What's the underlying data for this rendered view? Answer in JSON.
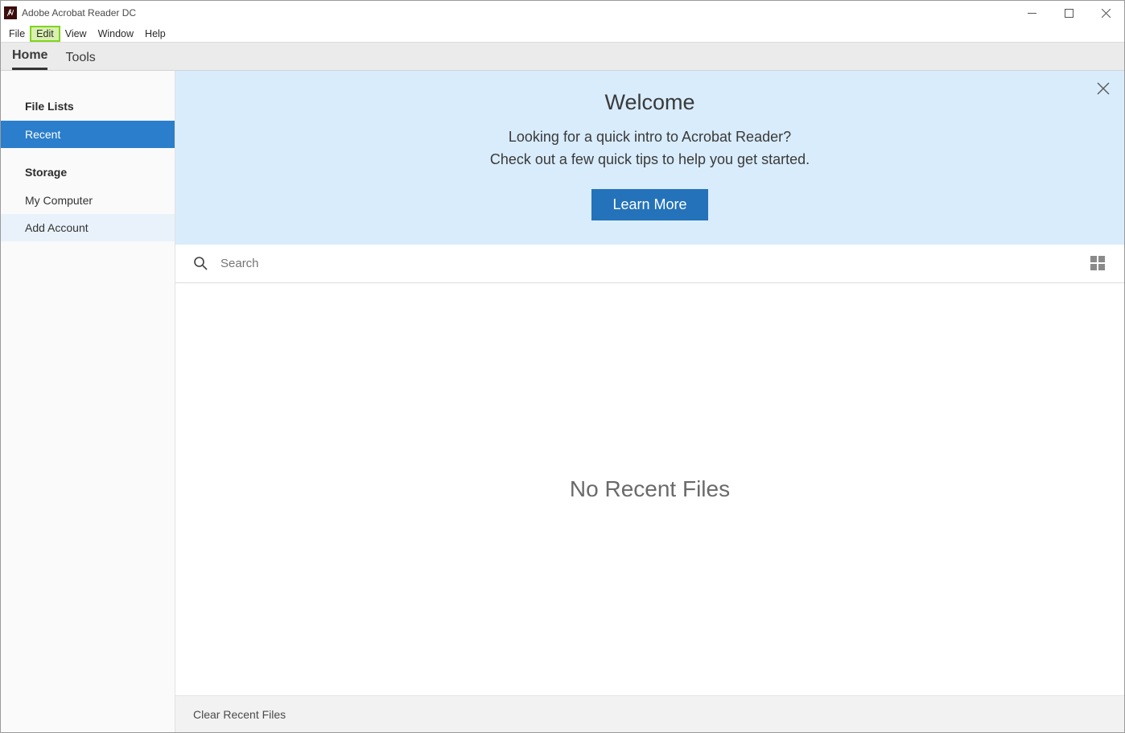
{
  "window": {
    "title": "Adobe Acrobat Reader DC"
  },
  "menubar": {
    "items": [
      {
        "label": "File",
        "highlighted": false
      },
      {
        "label": "Edit",
        "highlighted": true
      },
      {
        "label": "View",
        "highlighted": false
      },
      {
        "label": "Window",
        "highlighted": false
      },
      {
        "label": "Help",
        "highlighted": false
      }
    ]
  },
  "tabs": {
    "items": [
      {
        "label": "Home",
        "active": true
      },
      {
        "label": "Tools",
        "active": false
      }
    ]
  },
  "sidebar": {
    "section1_header": "File Lists",
    "section1_items": [
      {
        "label": "Recent",
        "selected": true
      }
    ],
    "section2_header": "Storage",
    "section2_items": [
      {
        "label": "My Computer",
        "selected": false,
        "soft": false
      },
      {
        "label": "Add Account",
        "selected": false,
        "soft": true
      }
    ]
  },
  "welcome": {
    "title": "Welcome",
    "line1": "Looking for a quick intro to Acrobat Reader?",
    "line2": "Check out a few quick tips to help you get started.",
    "button": "Learn More"
  },
  "search": {
    "placeholder": "Search",
    "value": ""
  },
  "content": {
    "empty_message": "No Recent Files"
  },
  "footer": {
    "clear_label": "Clear Recent Files"
  }
}
